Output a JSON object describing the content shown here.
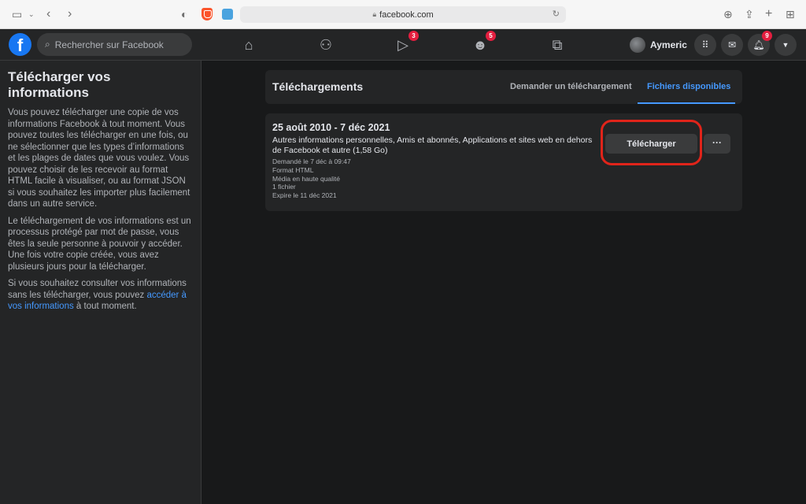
{
  "browser": {
    "url": "facebook.com"
  },
  "header": {
    "logo": "f",
    "search_placeholder": "Rechercher sur Facebook",
    "badges": {
      "watch": "3",
      "groups": "5",
      "notifications": "9"
    },
    "profile_name": "Aymeric"
  },
  "sidebar": {
    "title": "Télécharger vos informations",
    "para1": "Vous pouvez télécharger une copie de vos informations Facebook à tout moment. Vous pouvez toutes les télécharger en une fois, ou ne sélectionner que les types d’informations et les plages de dates que vous voulez. Vous pouvez choisir de les recevoir au format HTML facile à visualiser, ou au format JSON si vous souhaitez les importer plus facilement dans un autre service.",
    "para2": "Le téléchargement de vos informations est un processus protégé par mot de passe, vous êtes la seule personne à pouvoir y accéder. Une fois votre copie créée, vous avez plusieurs jours pour la télécharger.",
    "para3_before": "Si vous souhaitez consulter vos informations sans les télécharger, vous pouvez ",
    "para3_link": "accéder à vos informations",
    "para3_after": " à tout moment."
  },
  "main": {
    "title": "Téléchargements",
    "tabs": [
      "Demander un téléchargement",
      "Fichiers disponibles"
    ],
    "file": {
      "date_range": "25 août 2010 - 7 déc 2021",
      "description": "Autres informations personnelles, Amis et abonnés, Applications et sites web en dehors de Facebook et autre (1,58 Go)",
      "meta": [
        "Demandé le 7 déc à 09:47",
        "Format HTML",
        "Média en haute qualité",
        "1 fichier",
        "Expire le 11 déc 2021"
      ],
      "download_label": "Télécharger",
      "more_label": "···"
    }
  },
  "colors": {
    "accent": "#4599ff",
    "highlight": "#e0241a",
    "fb_blue": "#1877f2"
  }
}
